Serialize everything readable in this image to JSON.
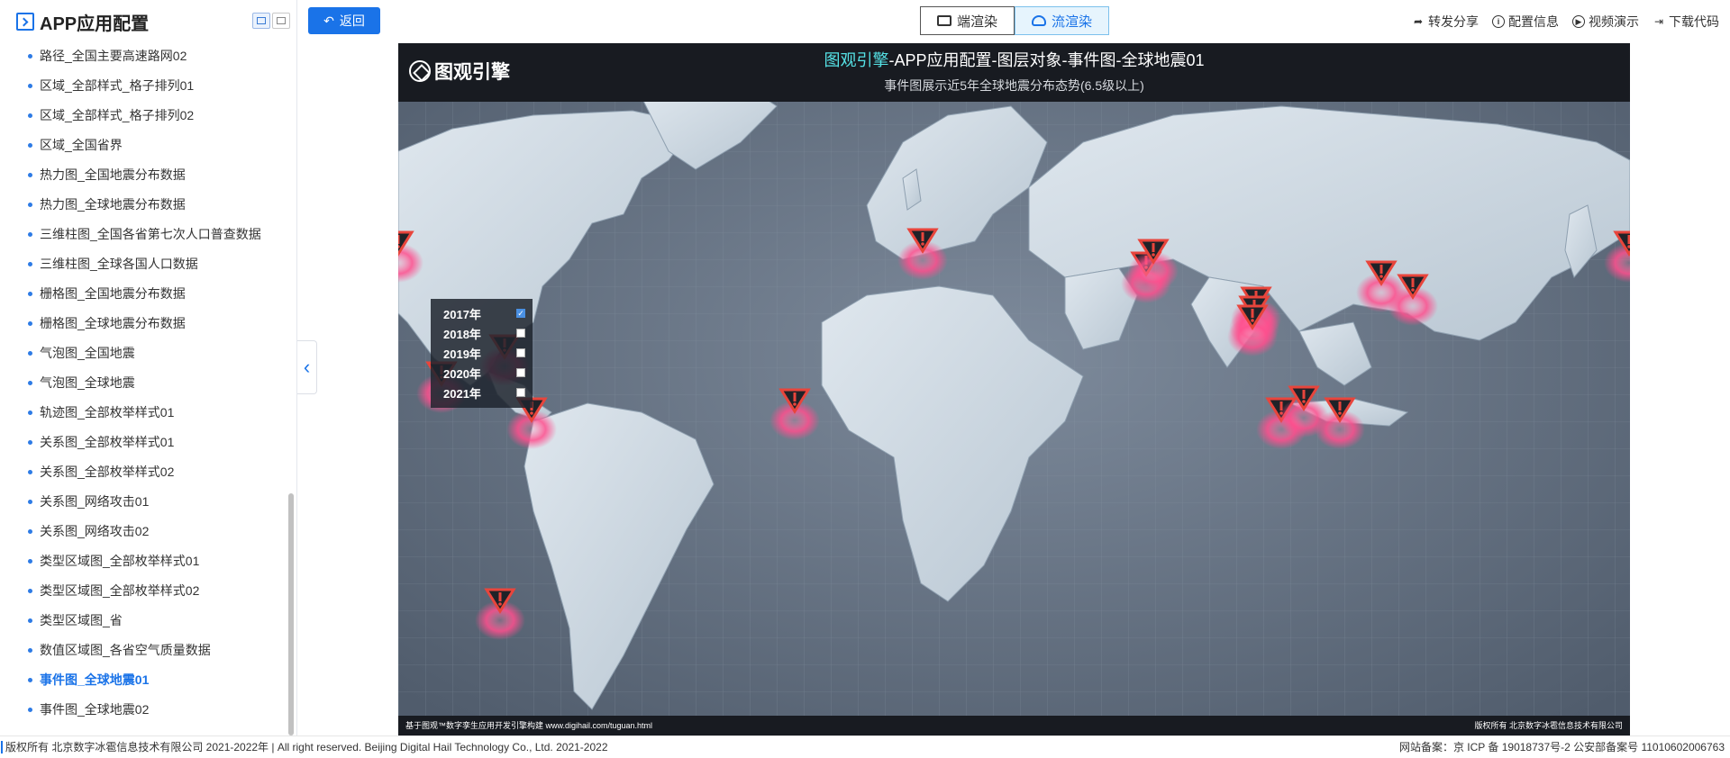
{
  "sidebar": {
    "title": "APP应用配置",
    "items": [
      {
        "label": "路径_全国主要高速路网02"
      },
      {
        "label": "区域_全部样式_格子排列01"
      },
      {
        "label": "区域_全部样式_格子排列02"
      },
      {
        "label": "区域_全国省界"
      },
      {
        "label": "热力图_全国地震分布数据"
      },
      {
        "label": "热力图_全球地震分布数据"
      },
      {
        "label": "三维柱图_全国各省第七次人口普查数据"
      },
      {
        "label": "三维柱图_全球各国人口数据"
      },
      {
        "label": "栅格图_全国地震分布数据"
      },
      {
        "label": "栅格图_全球地震分布数据"
      },
      {
        "label": "气泡图_全国地震"
      },
      {
        "label": "气泡图_全球地震"
      },
      {
        "label": "轨迹图_全部枚举样式01"
      },
      {
        "label": "关系图_全部枚举样式01"
      },
      {
        "label": "关系图_全部枚举样式02"
      },
      {
        "label": "关系图_网络攻击01"
      },
      {
        "label": "关系图_网络攻击02"
      },
      {
        "label": "类型区域图_全部枚举样式01"
      },
      {
        "label": "类型区域图_全部枚举样式02"
      },
      {
        "label": "类型区域图_省"
      },
      {
        "label": "数值区域图_各省空气质量数据"
      },
      {
        "label": "事件图_全球地震01",
        "active": true
      },
      {
        "label": "事件图_全球地震02"
      }
    ]
  },
  "toolbar": {
    "back_label": "返回",
    "render_client": "端渲染",
    "render_stream": "流渲染",
    "actions": [
      "转发分享",
      "配置信息",
      "视频演示",
      "下载代码"
    ]
  },
  "viewer": {
    "brand": "图观引擎",
    "title_highlight": "图观引擎",
    "title_rest": "-APP应用配置-图层对象-事件图-全球地震01",
    "subtitle": "事件图展示近5年全球地震分布态势(6.5级以上)",
    "years": [
      {
        "label": "2017年",
        "checked": true
      },
      {
        "label": "2018年",
        "checked": false
      },
      {
        "label": "2019年",
        "checked": false
      },
      {
        "label": "2020年",
        "checked": false
      },
      {
        "label": "2021年",
        "checked": false
      }
    ],
    "footer_left": "基于图观™数字孪生应用开发引擎构建 www.digihail.com/tuguan.html",
    "footer_right": "版权所有 北京数字冰雹信息技术有限公司",
    "event_marker_color": "#e8453c",
    "ripple_color": "#ff4f8e"
  },
  "page_footer": {
    "left": "版权所有 北京数字冰雹信息技术有限公司 2021-2022年 | All right reserved. Beijing Digital Hail Technology Co., Ltd. 2021-2022",
    "right": "网站备案：京 ICP 备 19018737号-2 公安部备案号 11010602006763"
  }
}
